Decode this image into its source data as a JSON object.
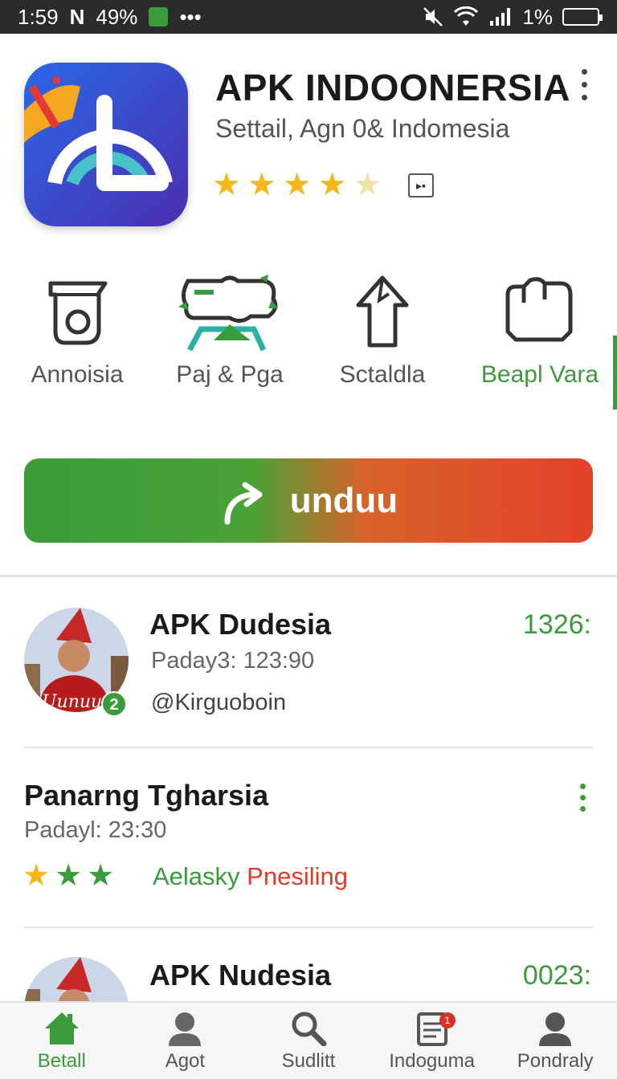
{
  "status_bar": {
    "time": "1:59",
    "notif_glyph": "N",
    "battery_left": "49%",
    "dots": "•••",
    "battery_right": "1%"
  },
  "app": {
    "title": "APK INDOONERSIA",
    "subtitle": "Settail, Agn 0& Indomesia",
    "rating": 4.5,
    "accent": "#3c9a3c"
  },
  "categories": [
    {
      "label": "Annoisia",
      "icon": "camera-icon",
      "active": false
    },
    {
      "label": "Paj & Pga",
      "icon": "landscape-icon",
      "active": false
    },
    {
      "label": "Sctaldla",
      "icon": "share-upload-icon",
      "active": false
    },
    {
      "label": "Beapl Vara",
      "icon": "bag-icon",
      "active": true
    }
  ],
  "download": {
    "label": "unduu",
    "icon": "redo-arrow-icon"
  },
  "list": [
    {
      "title": "APK Dudesia",
      "sub": "Paday3: 123:90",
      "handle": "@Kirguoboin",
      "time": "1326:",
      "badge": "2"
    },
    {
      "title": "Panarng Tgharsia",
      "sub": "Padayl: 23:30",
      "tag_green": "Aelasky",
      "tag_red": "Pnesiling",
      "rating": 3
    },
    {
      "title": "APK Nudesia",
      "sub": "",
      "time": "0023:"
    }
  ],
  "nav": [
    {
      "label": "Betall",
      "icon": "home-icon",
      "active": true
    },
    {
      "label": "Agot",
      "icon": "person-icon",
      "active": false
    },
    {
      "label": "Sudlitt",
      "icon": "search-icon",
      "active": false
    },
    {
      "label": "Indoguma",
      "icon": "document-icon",
      "active": false,
      "badge": "1"
    },
    {
      "label": "Pondraly",
      "icon": "profile-icon",
      "active": false
    }
  ]
}
